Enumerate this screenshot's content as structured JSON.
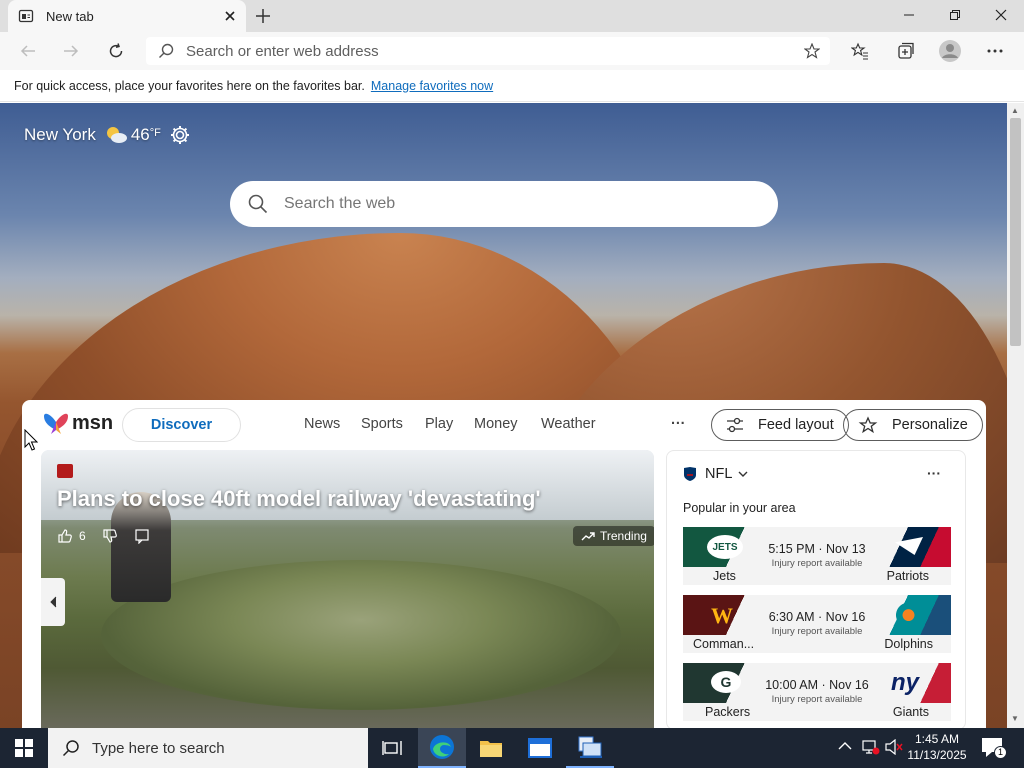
{
  "browser": {
    "tab_title": "New tab",
    "address_placeholder": "Search or enter web address",
    "favorites_bar_text": "For quick access, place your favorites here on the favorites bar.",
    "favorites_bar_link": "Manage favorites now"
  },
  "weather": {
    "city": "New York",
    "temp": "46",
    "unit": "°F"
  },
  "search": {
    "placeholder": "Search the web"
  },
  "msn": {
    "logo": "msn",
    "nav": [
      "Discover",
      "News",
      "Sports",
      "Play",
      "Money",
      "Weather"
    ],
    "more": "···",
    "feed_layout": "Feed layout",
    "personalize": "Personalize"
  },
  "hero": {
    "title": "Plans to close 40ft model railway 'devastating'",
    "likes": "6",
    "badge": "Trending"
  },
  "nfl": {
    "title": "NFL",
    "subtitle": "Popular in your area",
    "more": "···",
    "games": [
      {
        "home": "Jets",
        "away": "Patriots",
        "time": "5:15 PM · Nov 13",
        "note": "Injury report available",
        "home_color": "#125740",
        "away_color": "#002244"
      },
      {
        "home": "Comman...",
        "away": "Dolphins",
        "time": "6:30 AM · Nov 16",
        "note": "Injury report available",
        "home_color": "#5a1414",
        "away_color": "#008e97"
      },
      {
        "home": "Packers",
        "away": "Giants",
        "time": "10:00 AM · Nov 16",
        "note": "Injury report available",
        "home_color": "#203731",
        "away_color": "#0b2265"
      }
    ]
  },
  "taskbar": {
    "search_placeholder": "Type here to search",
    "time": "1:45 AM",
    "date": "11/13/2025",
    "notification_count": "1"
  }
}
